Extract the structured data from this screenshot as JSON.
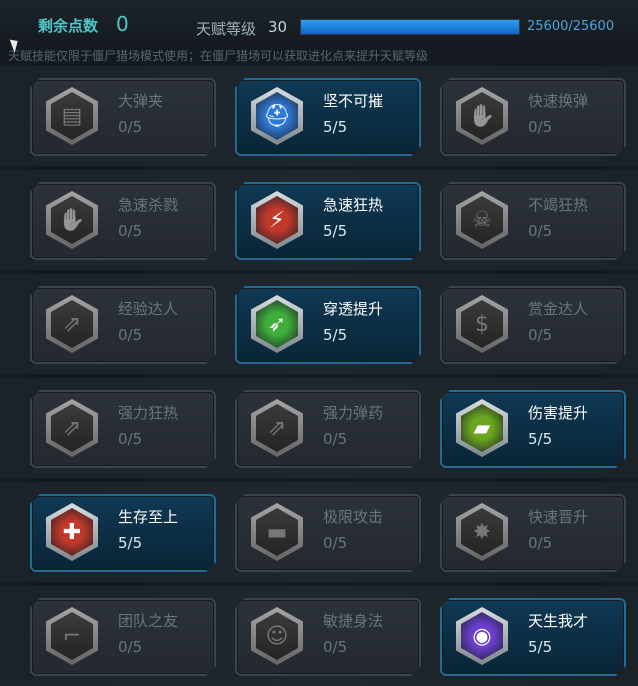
{
  "header": {
    "points_label": "剩余点数",
    "points_value": "0",
    "level_label": "天赋等级",
    "level_value": "30",
    "exp_text": "25600/25600",
    "exp_progress": 1.0,
    "notice": "天赋技能仅限于僵尸猎场模式使用；在僵尸猎场可以获取进化点来提升天赋等级"
  },
  "talents": [
    {
      "name": "大弹夹",
      "level": "0/5",
      "icon": "magazine-icon",
      "glyph": "▤",
      "active": false
    },
    {
      "name": "坚不可摧",
      "level": "5/5",
      "icon": "helmet-icon",
      "glyph": "⛑",
      "active": true,
      "color": "#2f7ad8"
    },
    {
      "name": "快速换弹",
      "level": "0/5",
      "icon": "reload-hand-icon",
      "glyph": "✋",
      "active": false
    },
    {
      "name": "急速杀戮",
      "level": "0/5",
      "icon": "kill-hand-icon",
      "glyph": "✋",
      "active": false
    },
    {
      "name": "急速狂热",
      "level": "5/5",
      "icon": "frenzy-icon",
      "glyph": "⚡",
      "active": true,
      "color": "#c0392b"
    },
    {
      "name": "不竭狂热",
      "level": "0/5",
      "icon": "skull-icon",
      "glyph": "☠",
      "active": false
    },
    {
      "name": "经验达人",
      "level": "0/5",
      "icon": "exp-arrow-icon",
      "glyph": "⇗",
      "active": false
    },
    {
      "name": "穿透提升",
      "level": "5/5",
      "icon": "penetrate-icon",
      "glyph": "➶",
      "active": true,
      "color": "#3fae3a"
    },
    {
      "name": "赏金达人",
      "level": "0/5",
      "icon": "bounty-coin-icon",
      "glyph": "$",
      "active": false
    },
    {
      "name": "强力狂热",
      "level": "0/5",
      "icon": "power-frenzy-icon",
      "glyph": "⇗",
      "active": false
    },
    {
      "name": "强力弹药",
      "level": "0/5",
      "icon": "power-ammo-icon",
      "glyph": "⇗",
      "active": false
    },
    {
      "name": "伤害提升",
      "level": "5/5",
      "icon": "rifle-icon",
      "glyph": "▰",
      "active": true,
      "color": "#6aa51e"
    },
    {
      "name": "生存至上",
      "level": "5/5",
      "icon": "medkit-icon",
      "glyph": "✚",
      "active": true,
      "color": "#c0392b"
    },
    {
      "name": "极限攻击",
      "level": "0/5",
      "icon": "turret-icon",
      "glyph": "▬",
      "active": false
    },
    {
      "name": "快速晋升",
      "level": "0/5",
      "icon": "rank-up-icon",
      "glyph": "✸",
      "active": false
    },
    {
      "name": "团队之友",
      "level": "0/5",
      "icon": "team-rifle-icon",
      "glyph": "⌐",
      "active": false
    },
    {
      "name": "敏捷身法",
      "level": "0/5",
      "icon": "agile-icon",
      "glyph": "☺",
      "active": false
    },
    {
      "name": "天生我才",
      "level": "5/5",
      "icon": "eye-icon",
      "glyph": "◉",
      "active": true,
      "color": "#6b3fd0"
    }
  ]
}
